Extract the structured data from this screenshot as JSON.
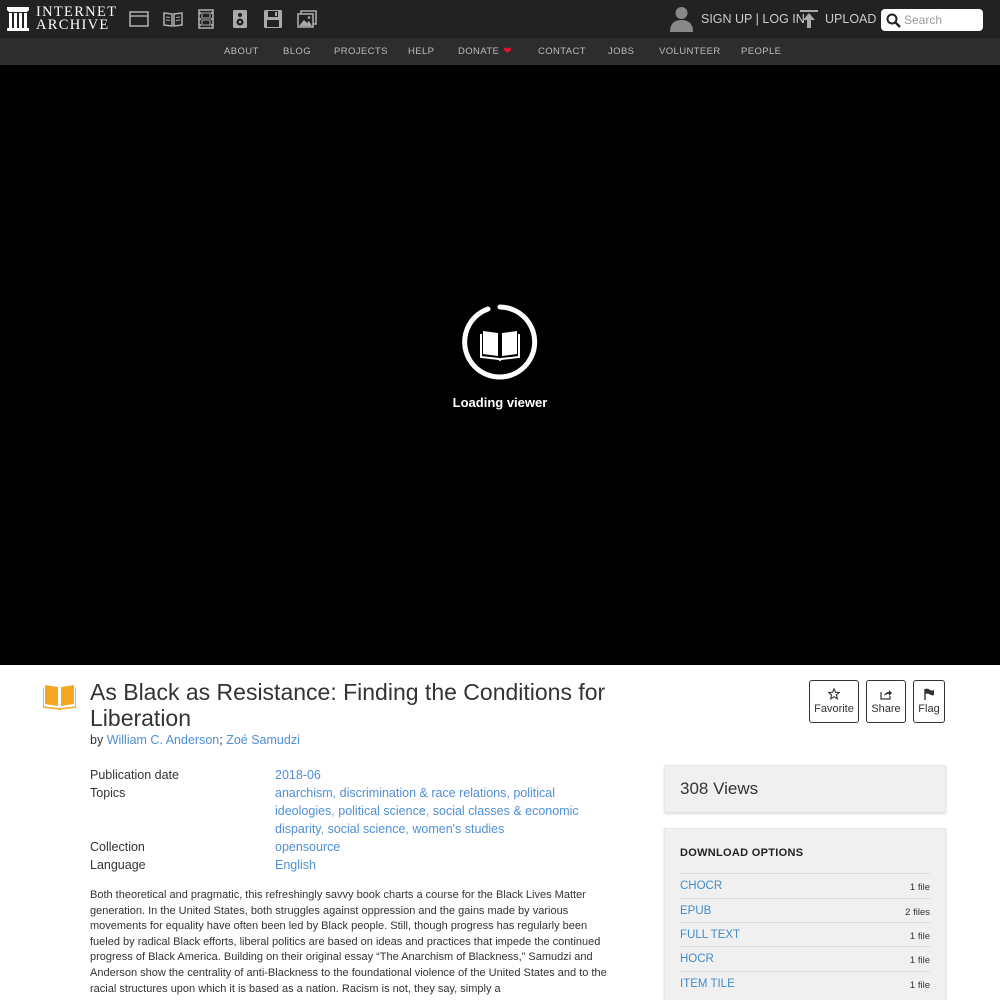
{
  "header": {
    "logo_line1": "INTERNET",
    "logo_line2": "ARCHIVE",
    "media_icons": [
      "web-icon",
      "texts-icon",
      "video-icon",
      "audio-icon",
      "software-icon",
      "images-icon"
    ],
    "sign_up": "SIGN UP",
    "separator": "|",
    "log_in": "LOG IN",
    "upload": "UPLOAD",
    "search_placeholder": "Search"
  },
  "subnav": {
    "items": [
      "ABOUT",
      "BLOG",
      "PROJECTS",
      "HELP",
      "DONATE",
      "CONTACT",
      "JOBS",
      "VOLUNTEER",
      "PEOPLE"
    ]
  },
  "viewer": {
    "loading_text": "Loading viewer"
  },
  "item": {
    "title": "As Black as Resistance: Finding the Conditions for Liberation",
    "by_label": "by",
    "authors": [
      "William C. Anderson",
      "Zoé Samudzi"
    ],
    "author_separator": ";",
    "actions": [
      "Favorite",
      "Share",
      "Flag"
    ],
    "metadata": {
      "publication_date_label": "Publication date",
      "publication_date": "2018-06",
      "topics_label": "Topics",
      "topics": [
        "anarchism",
        "discrimination & race relations",
        "political ideologies",
        "political science",
        "social classes & economic disparity",
        "social science",
        "women's studies"
      ],
      "collection_label": "Collection",
      "collection": "opensource",
      "language_label": "Language",
      "language": "English"
    },
    "description": "Both theoretical and pragmatic, this refreshingly savvy book charts a course for the Black Lives Matter generation. In the United States, both struggles against oppression and the gains made by various movements for equality have often been led by Black people. Still, though progress has regularly been fueled by radical Black efforts, liberal politics are based on ideas and practices that impede the continued progress of Black America. Building on their original essay “The Anarchism of Blackness,” Samudzi and Anderson show the centrality of anti-Blackness to the foundational violence of the United States and to the racial structures upon which it is based as a nation. Racism is not, they say, simply a"
  },
  "sidebar": {
    "views": "308 Views",
    "download_title": "DOWNLOAD OPTIONS",
    "downloads": [
      {
        "label": "CHOCR",
        "count": "1 file"
      },
      {
        "label": "EPUB",
        "count": "2 files"
      },
      {
        "label": "FULL TEXT",
        "count": "1 file"
      },
      {
        "label": "HOCR",
        "count": "1 file"
      },
      {
        "label": "ITEM TILE",
        "count": "1 file"
      }
    ]
  },
  "colors": {
    "topbar": "#222222",
    "subnav": "#2d2d2d",
    "link": "#428bca",
    "book_icon": "#f5a623",
    "heart": "#e0112a"
  }
}
